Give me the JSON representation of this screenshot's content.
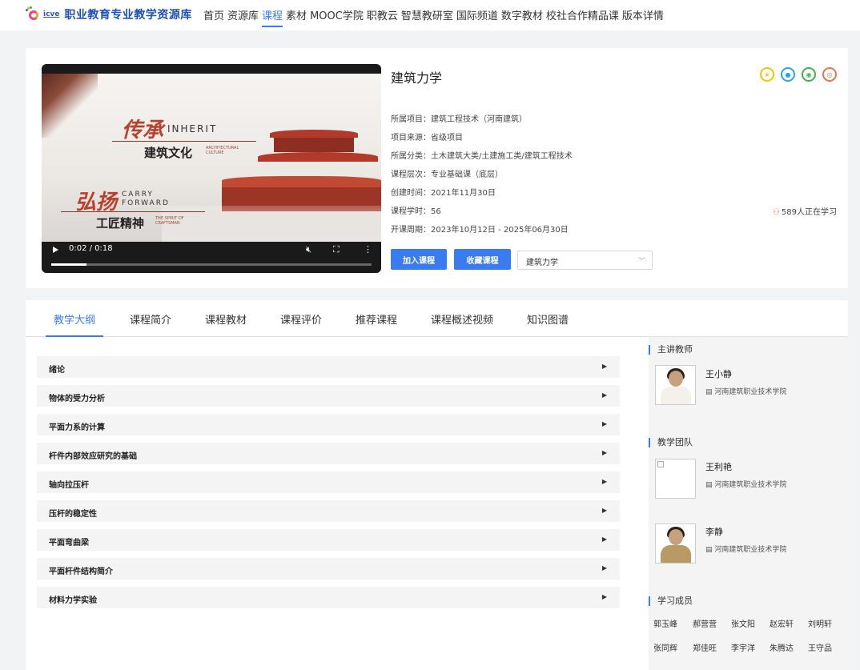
{
  "header": {
    "logo_small": "icve",
    "logo_title": "职业教育专业教学资源库",
    "nav": [
      "首页",
      "资源库",
      "课程",
      "素材",
      "MOOC学院",
      "职教云",
      "智慧教研室",
      "国际频道",
      "数字教材",
      "校社合作精品课",
      "版本详情"
    ],
    "active_nav": "课程"
  },
  "video": {
    "title_big_1": "传承",
    "title_eng_1": "INHERIT",
    "subtitle_1": "建筑文化",
    "tiny_1": "ARCHITECTURAL CULTURE",
    "title_big_2": "弘扬",
    "title_eng_2": "CARRY FORWARD",
    "subtitle_2": "工匠精神",
    "tiny_2": "THE SPIRIT OF CRAFTSMAN",
    "time": "0:02 / 0:18",
    "progress": 0.11
  },
  "course": {
    "title": "建筑力学",
    "project_label": "所属项目：",
    "project": "建筑工程技术（河南建筑）",
    "source_label": "项目来源：",
    "source": "省级项目",
    "category_label": "所属分类：",
    "category": "土木建筑大类/土建施工类/建筑工程技术",
    "level_label": "课程层次：",
    "level": "专业基础课（底层）",
    "created_label": "创建时间：",
    "created": "2021年11月30日",
    "hours_label": "课程学时：",
    "hours": "56",
    "period_label": "开课周期：",
    "period": "2023年10月12日 - 2025年06月30日",
    "learners": "589人正在学习",
    "join_button": "加入课程",
    "collect_button": "收藏课程",
    "select_value": "建筑力学",
    "share_colors": [
      "#f5c400",
      "#2aa6e8",
      "#3ab54a",
      "#e9734a"
    ]
  },
  "tabs": [
    "教学大纲",
    "课程简介",
    "课程教材",
    "课程评价",
    "推荐课程",
    "课程概述视频",
    "知识图谱"
  ],
  "outline": [
    "绪论",
    "物体的受力分析",
    "平面力系的计算",
    "杆件内部效应研究的基础",
    "轴向拉压杆",
    "压杆的稳定性",
    "平面弯曲梁",
    "平面杆件结构简介",
    "材料力学实验"
  ],
  "sidebar": {
    "lecturer_heading": "主讲教师",
    "lecturer": {
      "name": "王小静",
      "school": "河南建筑职业技术学院"
    },
    "team_heading": "教学团队",
    "team": [
      {
        "name": "王利艳",
        "school": "河南建筑职业技术学院"
      },
      {
        "name": "李静",
        "school": "河南建筑职业技术学院"
      }
    ],
    "members_heading": "学习成员",
    "members": [
      "郭玉峰",
      "郝营营",
      "张文阳",
      "赵宏轩",
      "刘明轩",
      "张同辉",
      "郑佳旺",
      "李宇洋",
      "朱腾达",
      "王守品"
    ]
  }
}
